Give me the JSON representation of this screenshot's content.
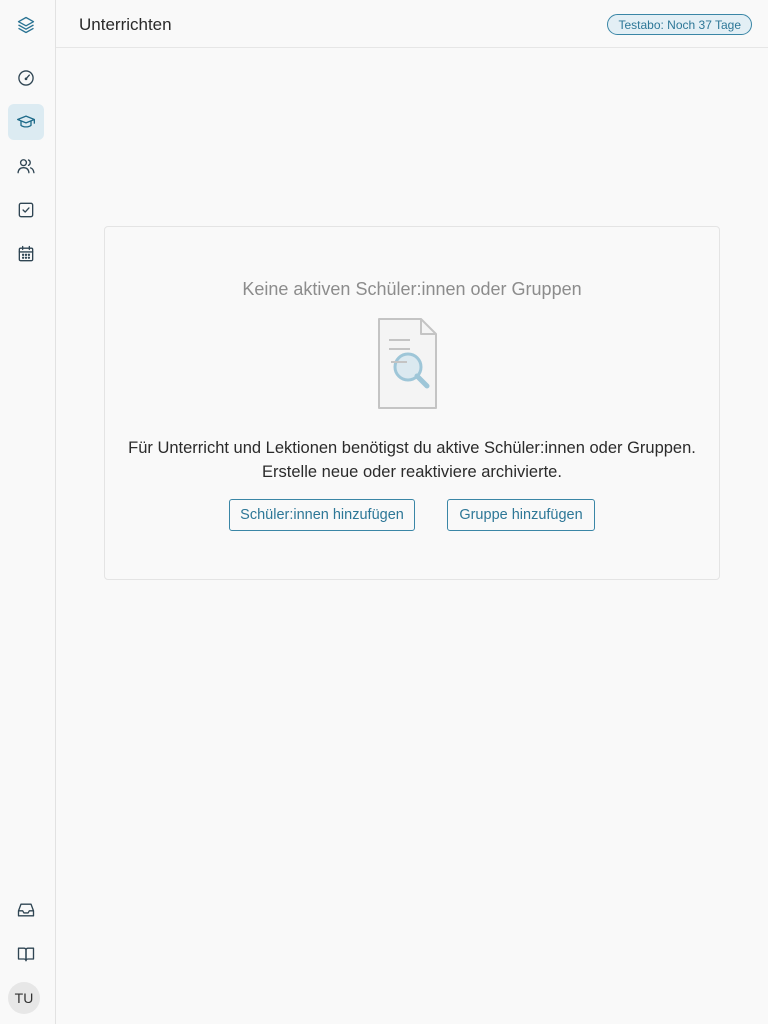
{
  "header": {
    "title": "Unterrichten",
    "trial_badge": "Testabo: Noch 37 Tage"
  },
  "sidebar": {
    "items": [
      {
        "icon": "layers-icon",
        "label": "Start"
      },
      {
        "icon": "gauge-icon",
        "label": "Dashboard"
      },
      {
        "icon": "graduation-cap-icon",
        "label": "Unterrichten",
        "active": true
      },
      {
        "icon": "users-icon",
        "label": "Schüler:innen"
      },
      {
        "icon": "checkbox-icon",
        "label": "Aufgaben"
      },
      {
        "icon": "calendar-icon",
        "label": "Kalender"
      }
    ],
    "bottom": [
      {
        "icon": "inbox-icon"
      },
      {
        "icon": "book-icon"
      }
    ],
    "avatar_initials": "TU"
  },
  "empty_state": {
    "title": "Keine aktiven Schüler:innen oder Gruppen",
    "line1": "Für Unterricht und Lektionen benötigst du aktive Schüler:innen oder Gruppen.",
    "line2": "Erstelle neue oder reaktiviere archivierte.",
    "add_students_label": "Schüler:innen hinzufügen",
    "add_group_label": "Gruppe hinzufügen",
    "icon": "document-search-icon"
  },
  "colors": {
    "accent": "#2d7797",
    "active_bg": "#dcebf2",
    "background": "#f9f9f9"
  }
}
